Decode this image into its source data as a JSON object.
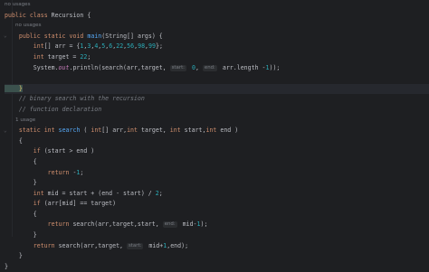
{
  "colors": {
    "background": "#1e1f22",
    "keyword": "#cf8e6d",
    "function": "#56a8f5",
    "number": "#2aacb8",
    "comment": "#7a7e85",
    "field": "#c77dbb",
    "text": "#bcbec4"
  },
  "hints": {
    "no_usages_1": "no usages",
    "no_usages_2": "no usages",
    "usages_1": "1 usage"
  },
  "code": {
    "l1": [
      "public",
      " ",
      "class",
      " Recursion {"
    ],
    "l2": [
      "    ",
      "public",
      " ",
      "static",
      " ",
      "void",
      " ",
      "main",
      "(String[] args) {"
    ],
    "l3": [
      "        int",
      "[] arr = {",
      "1",
      ",",
      "3",
      ",",
      "4",
      ",",
      "5",
      ",",
      "6",
      ",",
      "22",
      ",",
      "56",
      ",",
      "98",
      ",",
      "99",
      "};"
    ],
    "l4": [
      "        int",
      " target = ",
      "22",
      ";"
    ],
    "l5": [
      "        System.",
      "out",
      ".println(search(arr,target, ",
      "start:",
      " 0",
      ", ",
      "end:",
      " arr.length -",
      "1",
      "));"
    ],
    "l7": [
      "    }"
    ],
    "l8": [
      "    // binary search with the recursion"
    ],
    "l9": [
      "    // function declaration"
    ],
    "l10": [
      "    ",
      "static",
      " ",
      "int",
      " ",
      "search",
      " ( ",
      "int",
      "[] arr,",
      "int",
      " target, ",
      "int",
      " start,",
      "int",
      " end )"
    ],
    "l11": [
      "    {"
    ],
    "l12": [
      "        ",
      "if",
      " (start > end )"
    ],
    "l13": [
      "        {"
    ],
    "l14": [
      "            ",
      "return",
      " -",
      "1",
      ";"
    ],
    "l15": [
      "        }"
    ],
    "l16": [
      "        ",
      "int",
      " mid = start + (end - start) / ",
      "2",
      ";"
    ],
    "l17": [
      "        ",
      "if",
      " (arr[mid] == target)"
    ],
    "l18": [
      "        {"
    ],
    "l19": [
      "            ",
      "return",
      " search(arr,target,start, ",
      "end:",
      " mid-",
      "1",
      ");"
    ],
    "l20": [
      "        }"
    ],
    "l21": [
      "        ",
      "return",
      " search(arr,target, ",
      "start:",
      " mid+",
      "1",
      ",end);"
    ],
    "l22": [
      "    }"
    ],
    "l23": [
      "}"
    ]
  }
}
